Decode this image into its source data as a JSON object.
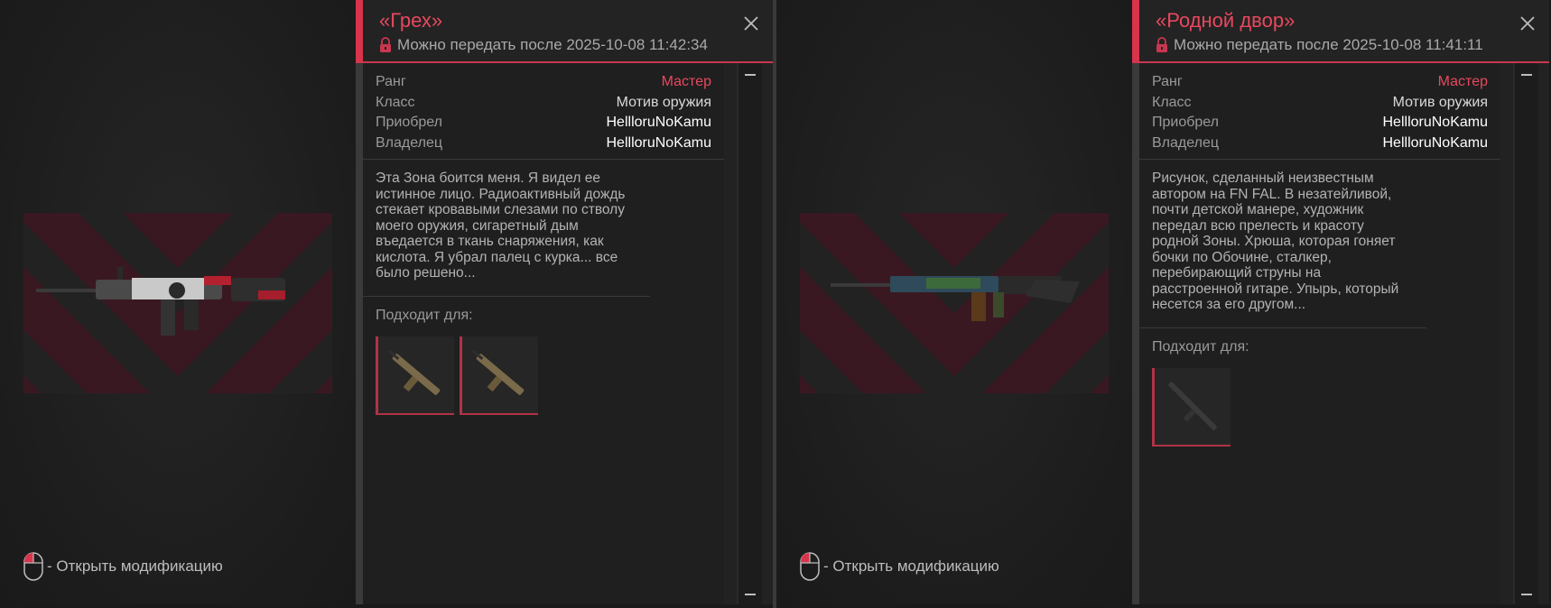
{
  "panels": [
    {
      "title": "«Грех»",
      "transfer_text": "Можно передать после 2025-10-08 11:42:34",
      "stats": [
        {
          "label": "Ранг",
          "value": "Мастер"
        },
        {
          "label": "Класс",
          "value": "Мотив оружия"
        },
        {
          "label": "Приобрел",
          "value": "HellloruNoKamu"
        },
        {
          "label": "Владелец",
          "value": "HellloruNoKamu"
        }
      ],
      "description": "Эта Зона боится меня. Я видел ее истинное лицо. Радиоактивный дождь стекает кровавыми слезами по стволу моего оружия, сигаретный дым въедается в ткань снаряжения, как кислота. Я убрал палец с курка... все было решено...",
      "fits_label": "Подходит для:",
      "fits_count": 2,
      "hint": "- Открыть модификацию"
    },
    {
      "title": "«Родной двор»",
      "transfer_text": "Можно передать после 2025-10-08 11:41:11",
      "stats": [
        {
          "label": "Ранг",
          "value": "Мастер"
        },
        {
          "label": "Класс",
          "value": "Мотив оружия"
        },
        {
          "label": "Приобрел",
          "value": "HellloruNoKamu"
        },
        {
          "label": "Владелец",
          "value": "HellloruNoKamu"
        }
      ],
      "description": "Рисунок, сделанный неизвестным автором на FN FAL. В незатейливой, почти детской манере, художник передал всю прелесть и красоту родной Зоны. Хрюша, которая гоняет бочки по Обочине, сталкер, перебирающий струны на расстроенной гитаре. Упырь, который несется за его другом...",
      "fits_label": "Подходит для:",
      "fits_count": 1,
      "hint": "- Открыть модификацию"
    }
  ],
  "colors": {
    "accent": "#e8485e",
    "background": "#1e1e1e",
    "preview_stripe": "#3a1821"
  },
  "icons": [
    "lock-icon",
    "close-icon",
    "mouse-icon",
    "scroll-minus-icon"
  ]
}
